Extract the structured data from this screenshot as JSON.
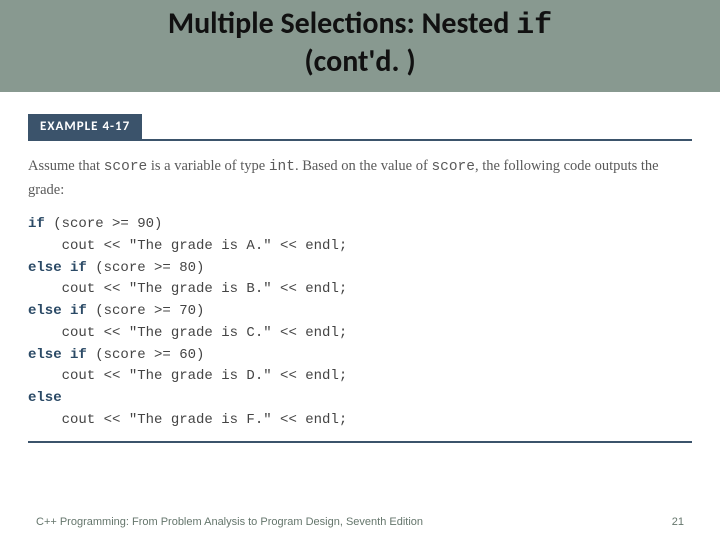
{
  "title": {
    "pre": "Multiple Selections: Nested ",
    "code": "if",
    "post": "(cont'd. )"
  },
  "example_label": "EXAMPLE 4-17",
  "intro": {
    "pre": "Assume that ",
    "var1": "score",
    "mid1": " is a variable of type ",
    "var2": "int",
    "mid2": ". Based on the value of ",
    "var3": "score",
    "post": ", the following code outputs the grade:"
  },
  "code": {
    "l1_kw": "if",
    "l1_rest": " (score >= 90)",
    "l2": "    cout << \"The grade is A.\" << endl;",
    "l3_kw": "else if",
    "l3_rest": " (score >= 80)",
    "l4": "    cout << \"The grade is B.\" << endl;",
    "l5_kw": "else if",
    "l5_rest": " (score >= 70)",
    "l6": "    cout << \"The grade is C.\" << endl;",
    "l7_kw": "else if",
    "l7_rest": " (score >= 60)",
    "l8": "    cout << \"The grade is D.\" << endl;",
    "l9_kw": "else",
    "l10": "    cout << \"The grade is F.\" << endl;"
  },
  "footer_text": "C++ Programming: From Problem Analysis to Program Design, Seventh Edition",
  "page_number": "21"
}
